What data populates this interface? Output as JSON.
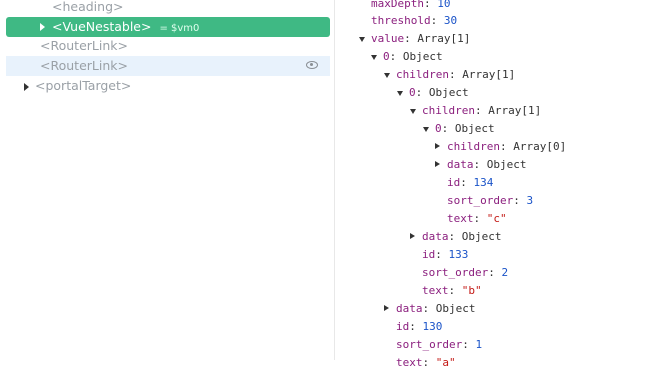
{
  "tree": {
    "items": [
      {
        "label": "<heading>"
      },
      {
        "label": "<VueNestable>",
        "vm": "= $vm0"
      },
      {
        "label": "<RouterLink>"
      },
      {
        "label": "<RouterLink>"
      },
      {
        "label": "<portalTarget>"
      }
    ]
  },
  "state": {
    "rows": [
      {
        "key": "maxDepth",
        "value": "10"
      },
      {
        "key": "threshold",
        "value": "30"
      },
      {
        "key": "value",
        "value": "Array[1]"
      },
      {
        "key": "0",
        "value": "Object"
      },
      {
        "key": "children",
        "value": "Array[1]"
      },
      {
        "key": "0",
        "value": "Object"
      },
      {
        "key": "children",
        "value": "Array[1]"
      },
      {
        "key": "0",
        "value": "Object"
      },
      {
        "key": "children",
        "value": "Array[0]"
      },
      {
        "key": "data",
        "value": "Object"
      },
      {
        "key": "id",
        "value": "134"
      },
      {
        "key": "sort_order",
        "value": "3"
      },
      {
        "key": "text",
        "value": "\"c\""
      },
      {
        "key": "data",
        "value": "Object"
      },
      {
        "key": "id",
        "value": "133"
      },
      {
        "key": "sort_order",
        "value": "2"
      },
      {
        "key": "text",
        "value": "\"b\""
      },
      {
        "key": "data",
        "value": "Object"
      },
      {
        "key": "id",
        "value": "130"
      },
      {
        "key": "sort_order",
        "value": "1"
      },
      {
        "key": "text",
        "value": "\"a\""
      }
    ]
  },
  "colors": {
    "selected_bg": "#3fb984",
    "hover_bg": "#e8f2fc",
    "key": "#8b1f7e",
    "number": "#1a53c8",
    "string": "#c41a16"
  }
}
